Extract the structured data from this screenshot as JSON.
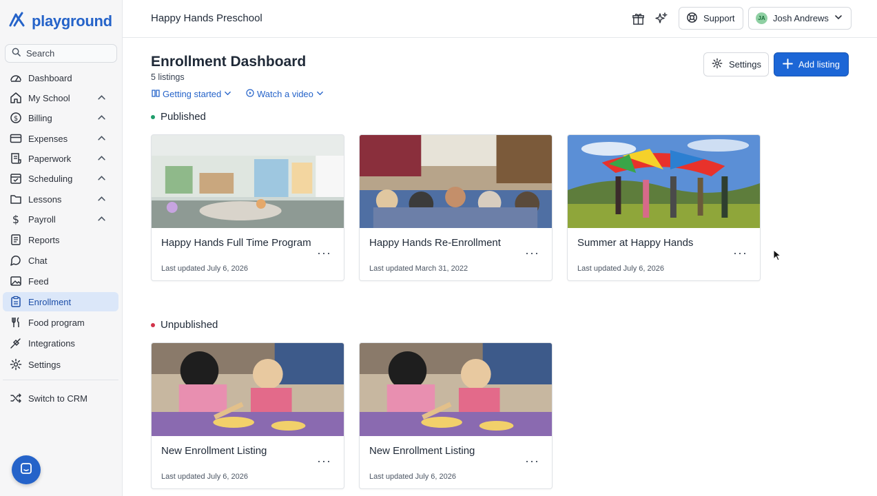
{
  "app": {
    "logo_text": "playground",
    "school_name": "Happy Hands Preschool"
  },
  "sidebar": {
    "search_placeholder": "Search",
    "items": [
      {
        "label": "Dashboard",
        "icon": "gauge-icon",
        "has_chevron": false
      },
      {
        "label": "My School",
        "icon": "home-icon",
        "has_chevron": true
      },
      {
        "label": "Billing",
        "icon": "dollar-circle-icon",
        "has_chevron": true
      },
      {
        "label": "Expenses",
        "icon": "card-icon",
        "has_chevron": true
      },
      {
        "label": "Paperwork",
        "icon": "receipt-icon",
        "has_chevron": true
      },
      {
        "label": "Scheduling",
        "icon": "calendar-check-icon",
        "has_chevron": true
      },
      {
        "label": "Lessons",
        "icon": "folder-icon",
        "has_chevron": true
      },
      {
        "label": "Payroll",
        "icon": "dollar-icon",
        "has_chevron": true
      },
      {
        "label": "Reports",
        "icon": "report-icon",
        "has_chevron": false
      },
      {
        "label": "Chat",
        "icon": "chat-icon",
        "has_chevron": false
      },
      {
        "label": "Feed",
        "icon": "image-icon",
        "has_chevron": false
      },
      {
        "label": "Enrollment",
        "icon": "clipboard-icon",
        "has_chevron": false,
        "active": true
      },
      {
        "label": "Food program",
        "icon": "utensils-icon",
        "has_chevron": false
      },
      {
        "label": "Integrations",
        "icon": "plug-icon",
        "has_chevron": false
      },
      {
        "label": "Settings",
        "icon": "gear-icon",
        "has_chevron": false
      }
    ],
    "switch_label": "Switch to CRM"
  },
  "topbar": {
    "support_label": "Support",
    "user_initials": "JA",
    "user_name": "Josh Andrews"
  },
  "main": {
    "title": "Enrollment Dashboard",
    "listing_count": "5 listings",
    "links": {
      "getting_started": "Getting started",
      "watch_video": "Watch a video"
    },
    "settings_label": "Settings",
    "add_listing_label": "Add listing",
    "published": {
      "label": "Published",
      "color": "#1f9d6b",
      "cards": [
        {
          "title": "Happy Hands Full Time Program",
          "updated": "Last updated July 6, 2026"
        },
        {
          "title": "Happy Hands Re-Enrollment",
          "updated": "Last updated March 31, 2022"
        },
        {
          "title": "Summer at Happy Hands",
          "updated": "Last updated July 6, 2026"
        }
      ]
    },
    "unpublished": {
      "label": "Unpublished",
      "color": "#d2334a",
      "cards": [
        {
          "title": "New Enrollment Listing",
          "updated": "Last updated July 6, 2026"
        },
        {
          "title": "New Enrollment Listing",
          "updated": "Last updated July 6, 2026"
        }
      ]
    }
  },
  "colors": {
    "brand": "#2563c9",
    "primary_button": "#1c66d6",
    "active_nav_bg": "#dbe7f9"
  }
}
